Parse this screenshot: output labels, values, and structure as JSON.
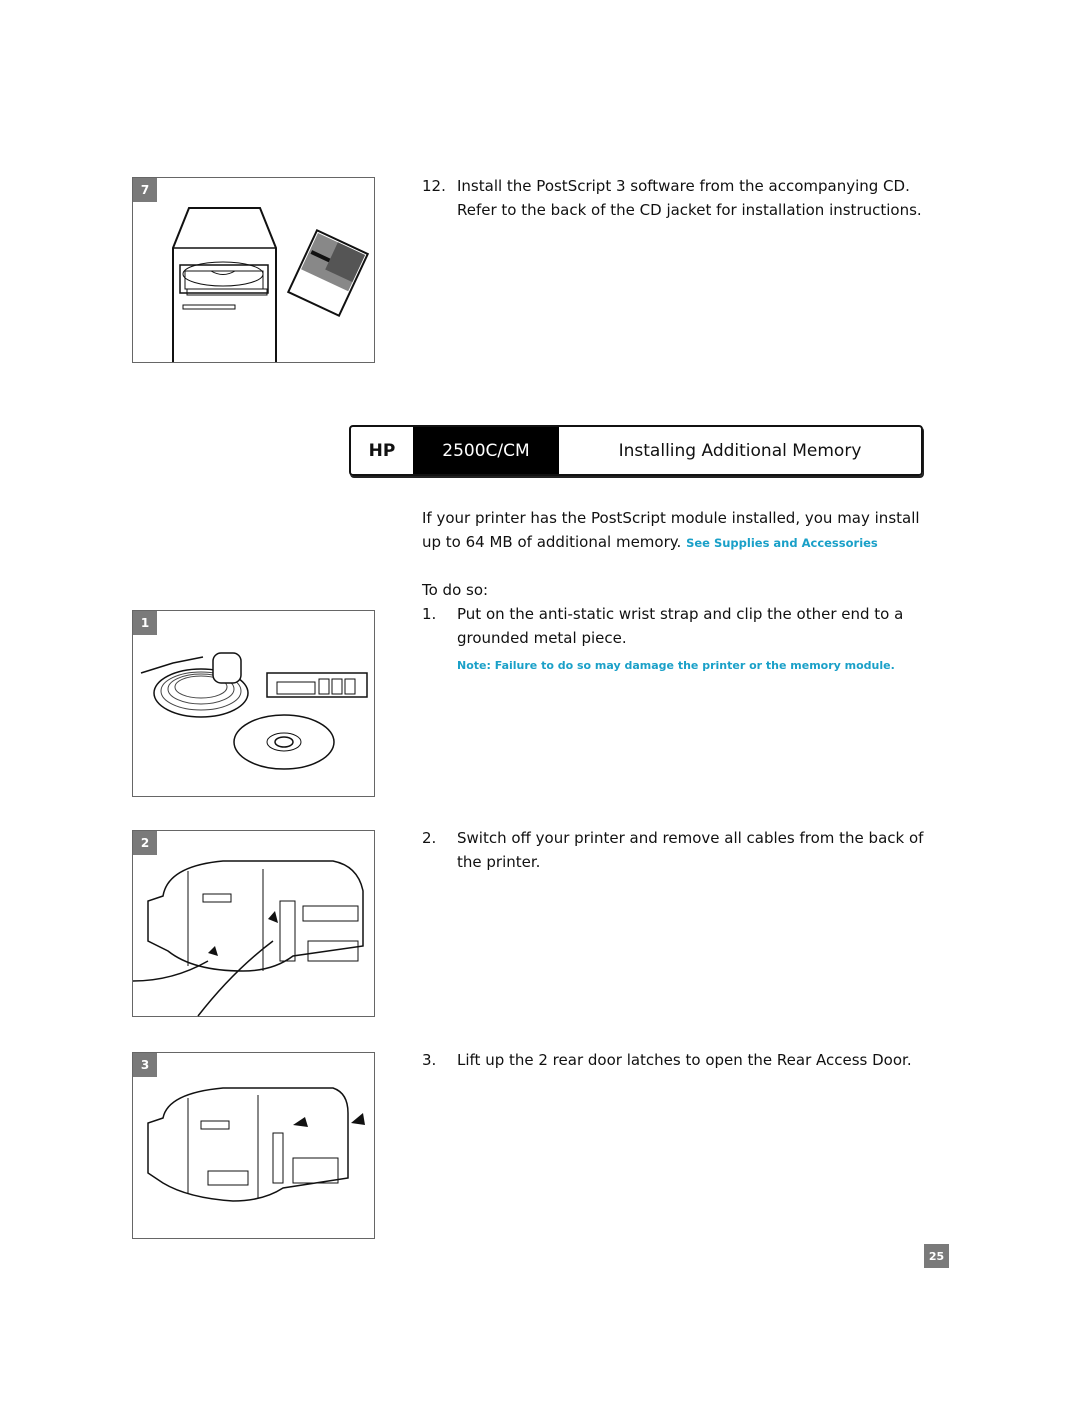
{
  "header": {
    "brand": "HP",
    "model": "2500C/CM",
    "title": "Installing Additional Memory"
  },
  "figures": [
    {
      "number": "7",
      "depicts": "computer tower with CD tray and CD jacket"
    },
    {
      "number": "1",
      "depicts": "anti-static wrist strap, memory module and CD"
    },
    {
      "number": "2",
      "depicts": "printer rear with cables being removed"
    },
    {
      "number": "3",
      "depicts": "printer rear with door latches being lifted"
    }
  ],
  "step12": {
    "number": "12.",
    "text": "Install the PostScript 3 software from the accompanying CD. Refer to the back of the CD jacket for installation instructions."
  },
  "intro": {
    "text": "If your printer has the PostScript module installed, you may install up to 64 MB of additional memory.",
    "link": "See Supplies and Accessories"
  },
  "todo_label": "To do so:",
  "steps": [
    {
      "number": "1.",
      "text": "Put on the anti-static wrist strap and clip the other end to a grounded metal piece.",
      "note": "Note: Failure to do so may damage the printer or the memory module."
    },
    {
      "number": "2.",
      "text": "Switch off your printer and remove all cables from the back of the printer."
    },
    {
      "number": "3.",
      "text": "Lift up the 2 rear door latches to open the Rear Access Door."
    }
  ],
  "page_number": "25",
  "colors": {
    "accent": "#1aa0c8",
    "badge": "#7a7a7a"
  }
}
